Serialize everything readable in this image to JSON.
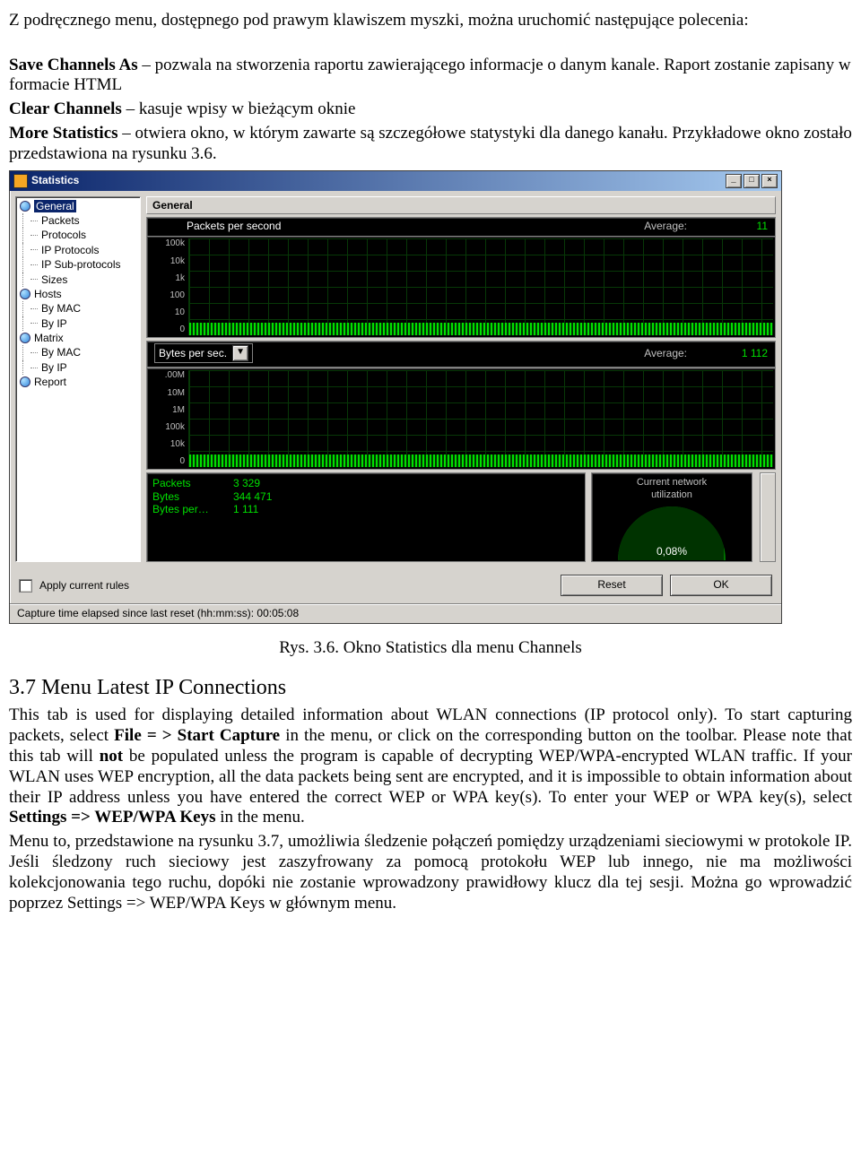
{
  "intro": {
    "p1": "Z podręcznego menu, dostępnego pod prawym klawiszem myszki, można uruchomić następujące polecenia:",
    "p2a": "Save Channels As",
    "p2b": " – pozwala na stworzenia raportu zawierającego informacje o danym kanale. Raport zostanie zapisany w formacie HTML",
    "p3a": "Clear Channels",
    "p3b": " – kasuje wpisy w bieżącym oknie",
    "p4a": "More Statistics",
    "p4b": " – otwiera okno, w którym zawarte są szczegółowe statystyki dla danego kanału. Przykładowe okno zostało przedstawiona na rysunku 3.6."
  },
  "window": {
    "title": "Statistics",
    "tree": {
      "items": [
        {
          "label": "General",
          "selected": true,
          "icon": true
        },
        {
          "label": "Packets",
          "child": true
        },
        {
          "label": "Protocols",
          "child": true
        },
        {
          "label": "IP Protocols",
          "child": true
        },
        {
          "label": "IP Sub-protocols",
          "child": true
        },
        {
          "label": "Sizes",
          "child": true
        },
        {
          "label": "Hosts",
          "icon": true
        },
        {
          "label": "By MAC",
          "child": true
        },
        {
          "label": "By IP",
          "child": true
        },
        {
          "label": "Matrix",
          "icon": true
        },
        {
          "label": "By MAC",
          "child": true
        },
        {
          "label": "By IP",
          "child": true
        },
        {
          "label": "Report",
          "icon": true
        }
      ]
    },
    "panel": {
      "title": "General",
      "graph1": {
        "label": "Packets per second",
        "avg_label": "Average:",
        "avg_value": "11",
        "yticks": [
          "100k",
          "10k",
          "1k",
          "100",
          "10",
          "0"
        ]
      },
      "graph2": {
        "dropdown": "Bytes per sec.",
        "avg_label": "Average:",
        "avg_value": "1 112",
        "yticks": [
          ".00M",
          "10M",
          "1M",
          "100k",
          "10k",
          "0"
        ]
      },
      "stats": {
        "rows": [
          {
            "k": "Packets",
            "v": "3 329"
          },
          {
            "k": "Bytes",
            "v": "344 471"
          },
          {
            "k": "Bytes per…",
            "v": "1 111"
          }
        ]
      },
      "gauge": {
        "title1": "Current network",
        "title2": "utilization",
        "value": "0,08%"
      }
    },
    "footer": {
      "checkbox_label": "Apply current rules",
      "reset": "Reset",
      "ok": "OK",
      "status": "Capture time elapsed since last reset (hh:mm:ss): 00:05:08"
    }
  },
  "caption": "Rys. 3.6. Okno Statistics dla menu Channels",
  "section": {
    "heading": "3.7 Menu Latest IP Connections",
    "body_pre": "This tab is used for displaying detailed information about WLAN connections (IP protocol only). To start capturing packets, select ",
    "b1": "File = > Start Capture",
    "body_mid1": " in the menu, or click on the corresponding button on the toolbar. Please note that this tab will ",
    "b2": "not",
    "body_mid2": " be populated unless the program is capable of decrypting WEP/WPA-encrypted WLAN traffic. If your WLAN uses WEP encryption, all the data packets being sent are encrypted, and it is impossible to obtain information about their IP address unless you have entered the correct WEP or WPA key(s). To enter your WEP or WPA key(s), select ",
    "b3": "Settings => WEP/WPA Keys",
    "body_post": " in the menu.",
    "body2": "Menu to, przedstawione na rysunku 3.7, umożliwia śledzenie połączeń pomiędzy urządzeniami sieciowymi w protokole IP. Jeśli śledzony ruch sieciowy jest zaszyfrowany za pomocą protokołu WEP lub innego, nie ma możliwości kolekcjonowania tego ruchu, dopóki nie zostanie wprowadzony prawidłowy klucz dla tej sesji. Można go wprowadzić poprzez Settings => WEP/WPA Keys w głównym menu."
  }
}
